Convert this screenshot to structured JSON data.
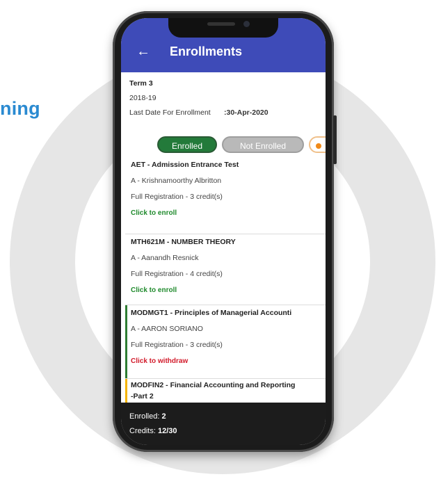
{
  "side_text": "ning",
  "appbar": {
    "back_icon": "arrow-left-icon",
    "title": "Enrollments"
  },
  "info": {
    "term": "Term 3",
    "year": "2018-19",
    "last_date_label": "Last Date For Enrollment",
    "last_date_value": ":30-Apr-2020"
  },
  "tabs": {
    "enrolled": "Enrolled",
    "not_enrolled": "Not Enrolled"
  },
  "courses": [
    {
      "name": "AET - Admission Entrance Test",
      "section": "A   - Krishnamoorthy Albritton",
      "registration": "Full Registration   - 3 credit(s)",
      "action": "Click to enroll",
      "status_color": ""
    },
    {
      "name": "MTH621M - NUMBER THEORY",
      "section": "A   - Aanandh Resnick",
      "registration": "Full Registration    - 4 credit(s)",
      "action": "Click to enroll",
      "status_color": ""
    },
    {
      "name": "MODMGT1 - Principles of Managerial Accounti",
      "section": "A   - AARON SORIANO",
      "registration": "Full Registration    - 3 credit(s)",
      "action": "Click to withdraw",
      "status_color": "#2e7d32"
    },
    {
      "name": "MODFIN2 - Financial Accounting and Reporting",
      "name2": "-Part 2",
      "status_color": "#f5b400"
    }
  ],
  "footer": {
    "enrolled_label": "Enrolled: ",
    "enrolled_value": "2",
    "credits_label": "Credits: ",
    "credits_value": "12/30"
  },
  "colors": {
    "appbar": "#3e4bb8",
    "enrolled_pill": "#237a3a",
    "enroll_text": "#1f8a2c",
    "withdraw_text": "#d21a2a",
    "side_text": "#2a8ad1"
  }
}
